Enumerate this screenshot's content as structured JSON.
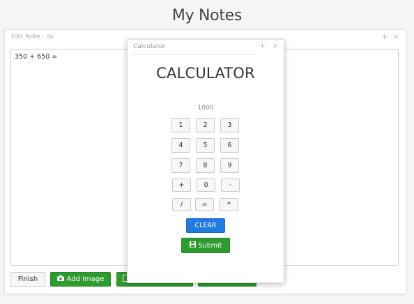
{
  "app": {
    "title": "My Notes"
  },
  "edit_panel": {
    "title": "Edit Note : ds",
    "content": "350 + 650 =",
    "add_icon": "+",
    "close_icon": "×"
  },
  "footer": {
    "finish": "Finish",
    "add_image": "Add Image"
  },
  "calculator": {
    "window_title": "Calculator",
    "add_icon": "+",
    "close_icon": "×",
    "heading": "CALCULATOR",
    "display": "1000",
    "keys": [
      "1",
      "2",
      "3",
      "4",
      "5",
      "6",
      "7",
      "8",
      "9",
      "+",
      "0",
      "-",
      "/",
      "=",
      "*"
    ],
    "clear": "CLEAR",
    "submit": "Submit"
  },
  "colors": {
    "green": "#2e9b2e",
    "blue": "#1e7be0"
  },
  "icons": {
    "add_image": "camera-icon",
    "submit": "save-icon"
  }
}
